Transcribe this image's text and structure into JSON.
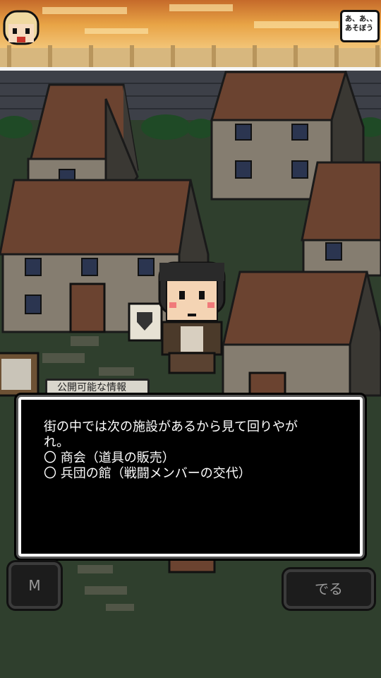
{
  "top_bar": {
    "speech_line1": "あ、あ、、",
    "speech_line2": "あそぼう"
  },
  "info_tag": {
    "label": "公開可能な情報"
  },
  "dialog": {
    "line1": "街の中では次の施設があるから見て回りやが",
    "line2": "れ。",
    "line3": "〇 商会（道具の販売）",
    "line4": "〇 兵団の館（戦闘メンバーの交代）"
  },
  "buttons": {
    "menu_label": "M",
    "exit_label": "でる"
  },
  "colors": {
    "sky": "#e0a040",
    "ground": "#2f3f2d",
    "roof": "#6b4330",
    "wall": "#857d70",
    "dialog_bg": "#000000",
    "dialog_text": "#ffffff"
  }
}
